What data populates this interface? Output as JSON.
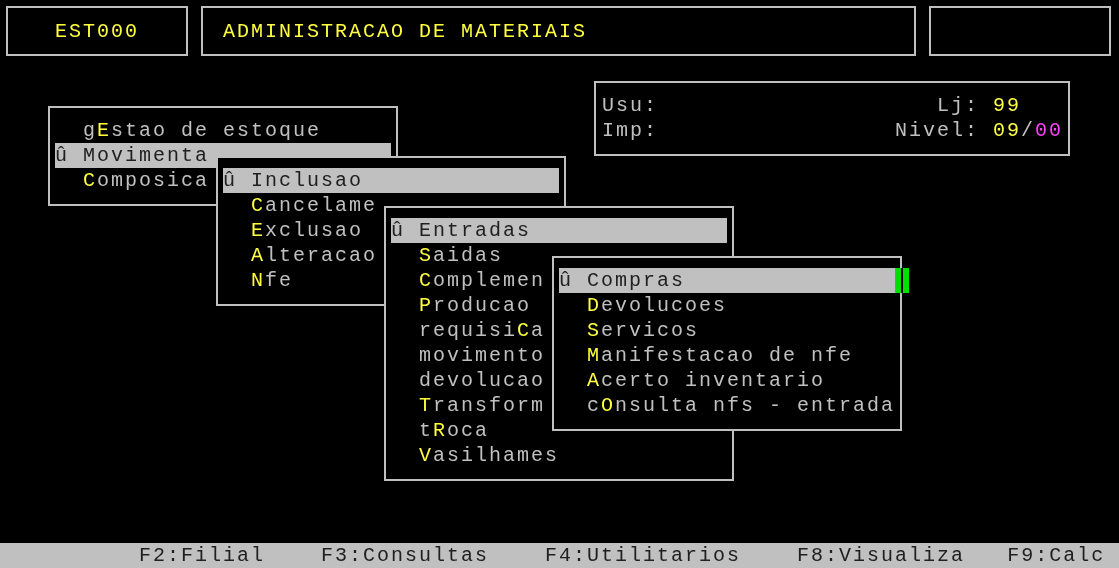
{
  "header": {
    "program_code": "EST000",
    "title": "ADMINISTRACAO DE MATERIAIS"
  },
  "session": {
    "user_label": "Usu:",
    "printer_label": "Imp:",
    "store_label": "Lj:",
    "store": "99",
    "level_label": "Nivel:",
    "level_value": "09",
    "level_separator": "/",
    "level_sub": "00"
  },
  "menus": [
    {
      "cursor": false,
      "items": [
        {
          "label": "g**E**stao de estoque",
          "selected": false
        },
        {
          "marker": "û",
          "label": "Movimenta",
          "selected": true
        },
        {
          "label": "**C**omposica",
          "selected": false
        }
      ]
    },
    {
      "cursor": false,
      "items": [
        {
          "marker": "û",
          "label": "Inclusao",
          "selected": true
        },
        {
          "label": "**C**ancelame",
          "selected": false
        },
        {
          "label": "**E**xclusao",
          "selected": false
        },
        {
          "label": "**A**lteracao",
          "selected": false
        },
        {
          "label": "**N**fe",
          "selected": false
        }
      ]
    },
    {
      "cursor": false,
      "items": [
        {
          "marker": "û",
          "label": "Entradas",
          "selected": true
        },
        {
          "label": "**S**aidas",
          "selected": false
        },
        {
          "label": "**C**omplemen",
          "selected": false
        },
        {
          "label": "**P**roducao",
          "selected": false
        },
        {
          "label": "requisi**C**a",
          "selected": false
        },
        {
          "label": "movimento",
          "selected": false
        },
        {
          "label": "devolucao",
          "selected": false
        },
        {
          "label": "**T**ransform",
          "selected": false
        },
        {
          "label": "t**R**oca",
          "selected": false
        },
        {
          "label": "**V**asilhames",
          "selected": false
        }
      ]
    },
    {
      "cursor": true,
      "items": [
        {
          "marker": "û",
          "label": "Compras",
          "selected": true
        },
        {
          "label": "**D**evolucoes",
          "selected": false
        },
        {
          "label": "**S**ervicos",
          "selected": false
        },
        {
          "label": "**M**anifestacao de nfe",
          "selected": false
        },
        {
          "label": "**A**certo inventario",
          "selected": false
        },
        {
          "label": "c**O**nsulta nfs - entrada",
          "selected": false
        }
      ]
    }
  ],
  "function_keys": [
    "F2:Filial",
    "F3:Consultas",
    "F4:Utilitarios",
    "F8:Visualiza",
    "F9:Calc"
  ]
}
